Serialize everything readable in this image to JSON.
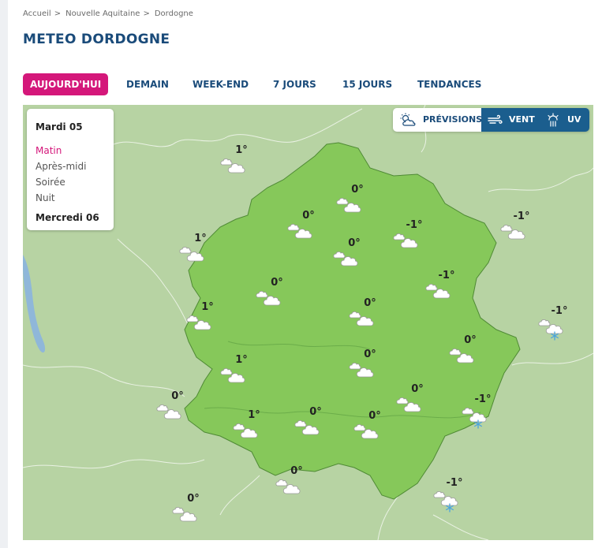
{
  "breadcrumb": [
    "Accueil",
    "Nouvelle Aquitaine",
    "Dordogne"
  ],
  "breadcrumb_separator": ">",
  "page_title": "METEO DORDOGNE",
  "tabs": [
    "AUJOURD'HUI",
    "DEMAIN",
    "WEEK-END",
    "7 JOURS",
    "15 JOURS",
    "TENDANCES"
  ],
  "active_tab": "AUJOURD'HUI",
  "colors": {
    "accent": "#d4177a",
    "primary": "#1a4b7a",
    "map_bg": "#b7d3a3",
    "dept_fill": "#86c85a",
    "toggle_active": "#1b5e8e"
  },
  "day_panel": {
    "day1": "Mardi 05",
    "periods": [
      "Matin",
      "Après-midi",
      "Soirée",
      "Nuit"
    ],
    "selected_period": "Matin",
    "day2": "Mercredi 06"
  },
  "map_modes": [
    {
      "label": "PRÉVISIONS",
      "icon": "cloud-sun-icon"
    },
    {
      "label": "VENT",
      "icon": "wind-icon"
    },
    {
      "label": "UV",
      "icon": "sun-rays-icon"
    }
  ],
  "forecasts": [
    {
      "temp": "1°",
      "icon": "cloud-icon"
    },
    {
      "temp": "0°",
      "icon": "cloud-icon"
    },
    {
      "temp": "0°",
      "icon": "cloud-icon"
    },
    {
      "temp": "-1°",
      "icon": "cloud-icon"
    },
    {
      "temp": "-1°",
      "icon": "cloud-icon"
    },
    {
      "temp": "1°",
      "icon": "cloud-icon"
    },
    {
      "temp": "0°",
      "icon": "cloud-icon"
    },
    {
      "temp": "-1°",
      "icon": "cloud-icon"
    },
    {
      "temp": "0°",
      "icon": "cloud-icon"
    },
    {
      "temp": "0°",
      "icon": "cloud-icon"
    },
    {
      "temp": "1°",
      "icon": "cloud-icon"
    },
    {
      "temp": "-1°",
      "icon": "cloud-snow-icon"
    },
    {
      "temp": "0°",
      "icon": "cloud-icon"
    },
    {
      "temp": "1°",
      "icon": "cloud-icon"
    },
    {
      "temp": "0°",
      "icon": "cloud-icon"
    },
    {
      "temp": "0°",
      "icon": "cloud-icon"
    },
    {
      "temp": "0°",
      "icon": "cloud-icon"
    },
    {
      "temp": "1°",
      "icon": "cloud-icon"
    },
    {
      "temp": "0°",
      "icon": "cloud-icon"
    },
    {
      "temp": "0°",
      "icon": "cloud-icon"
    },
    {
      "temp": "-1°",
      "icon": "cloud-snow-icon"
    },
    {
      "temp": "0°",
      "icon": "cloud-icon"
    },
    {
      "temp": "-1°",
      "icon": "cloud-snow-icon"
    },
    {
      "temp": "0°",
      "icon": "cloud-icon"
    }
  ]
}
